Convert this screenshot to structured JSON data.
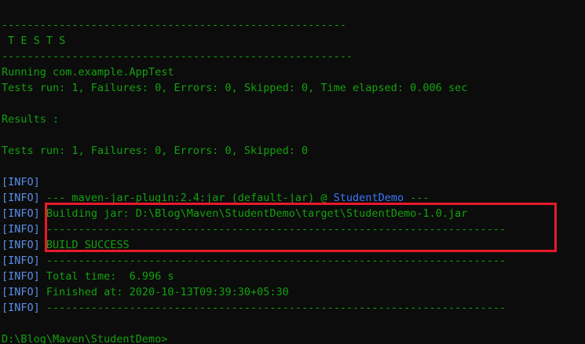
{
  "terminal": {
    "lines": [
      {
        "text": "------------------------------------------------------"
      },
      {
        "text": " T E S T S"
      },
      {
        "text": "-------------------------------------------------------"
      },
      {
        "text": "Running com.example.AppTest"
      },
      {
        "text": "Tests run: 1, Failures: 0, Errors: 0, Skipped: 0, Time elapsed: 0.006 sec"
      },
      {
        "text": ""
      },
      {
        "text": "Results :"
      },
      {
        "text": ""
      },
      {
        "text": "Tests run: 1, Failures: 0, Errors: 0, Skipped: 0"
      },
      {
        "text": ""
      },
      {
        "tag": "INFO",
        "text": ""
      },
      {
        "tag": "INFO",
        "text": " --- maven-jar-plugin:2.4:jar (default-jar) @ ",
        "highlight": "StudentDemo",
        "suffix": " ---"
      },
      {
        "tag": "INFO",
        "text": " Building jar: D:\\Blog\\Maven\\StudentDemo\\target\\StudentDemo-1.0.jar"
      },
      {
        "tag": "INFO",
        "text": " ------------------------------------------------------------------------"
      },
      {
        "tag": "INFO",
        "text": " BUILD SUCCESS"
      },
      {
        "tag": "INFO",
        "text": " ------------------------------------------------------------------------"
      },
      {
        "tag": "INFO",
        "text": " Total time:  6.996 s"
      },
      {
        "tag": "INFO",
        "text": " Finished at: 2020-10-13T09:39:30+05:30"
      },
      {
        "tag": "INFO",
        "text": " ------------------------------------------------------------------------"
      },
      {
        "text": ""
      }
    ],
    "prompt": "D:\\Blog\\Maven\\StudentDemo>",
    "colors": {
      "background": "#0c0c0c",
      "text": "#13a10e",
      "tag": "#5b8de8",
      "highlight": "#3b78ff",
      "box": "#e8192c"
    }
  }
}
